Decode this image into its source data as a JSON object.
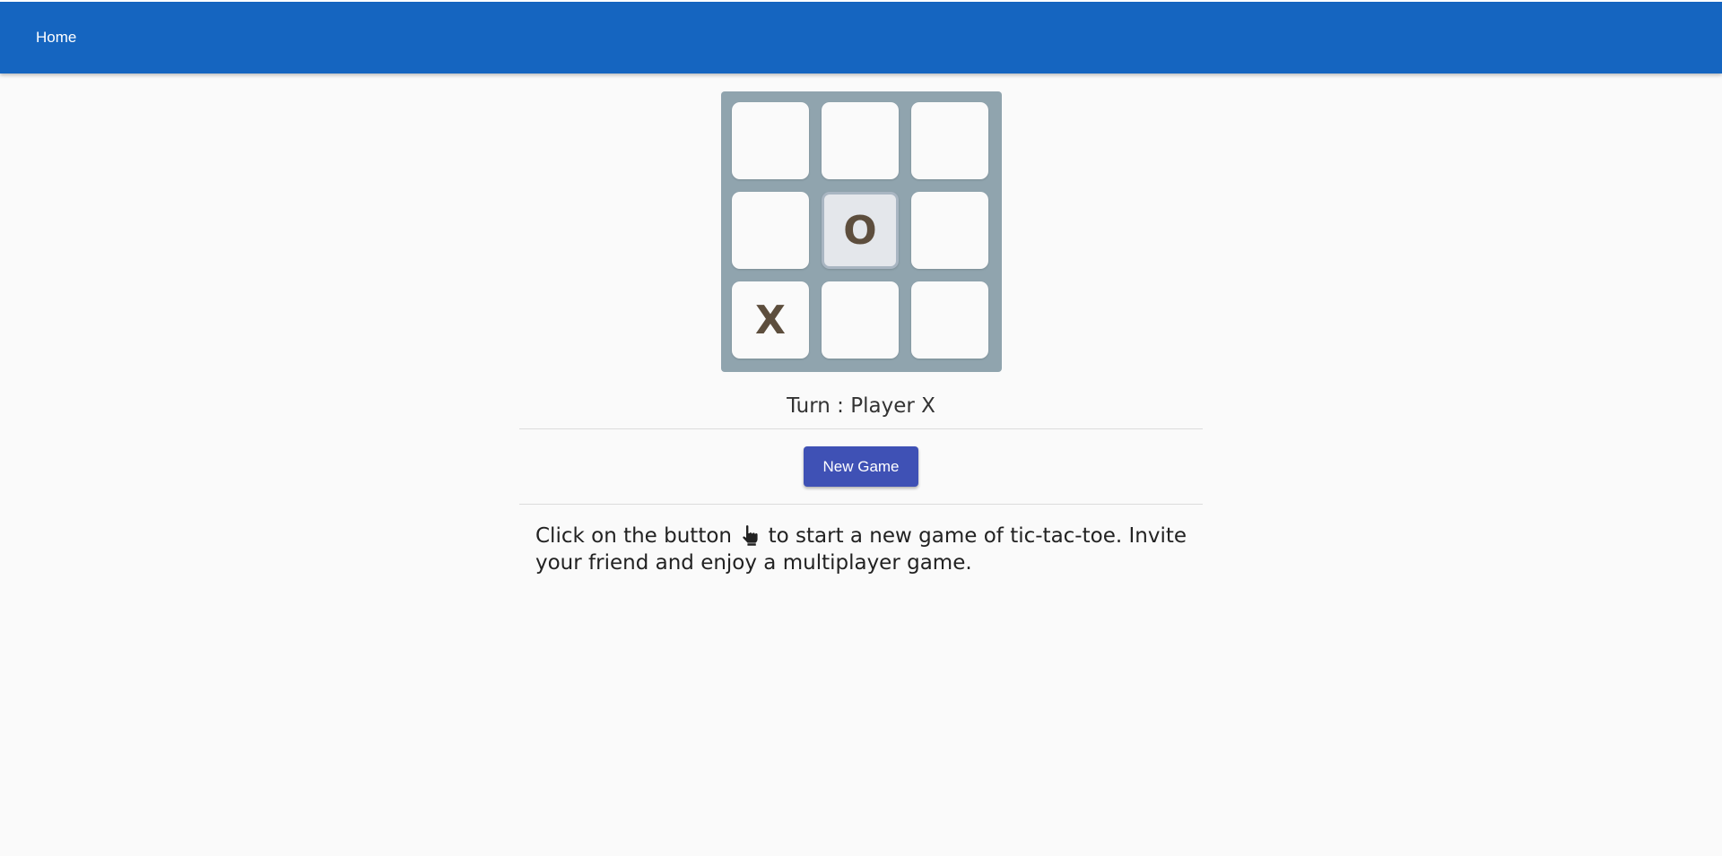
{
  "nav": {
    "home_label": "Home"
  },
  "board": {
    "cells": [
      "",
      "",
      "",
      "",
      "O",
      "",
      "X",
      "",
      ""
    ],
    "active_cell": 4
  },
  "status": {
    "turn_text": "Turn : Player X"
  },
  "actions": {
    "new_game_label": "New Game"
  },
  "instructions": {
    "before_icon": "Click on the button",
    "icon": "pointer-hand-icon",
    "after_icon": "to start a new game of tic-tac-toe. Invite your friend and enjoy a multiplayer game."
  },
  "colors": {
    "header": "#1565c0",
    "board_background": "#90a4ae",
    "button": "#3f51b5",
    "mark": "#5d4e3d"
  }
}
